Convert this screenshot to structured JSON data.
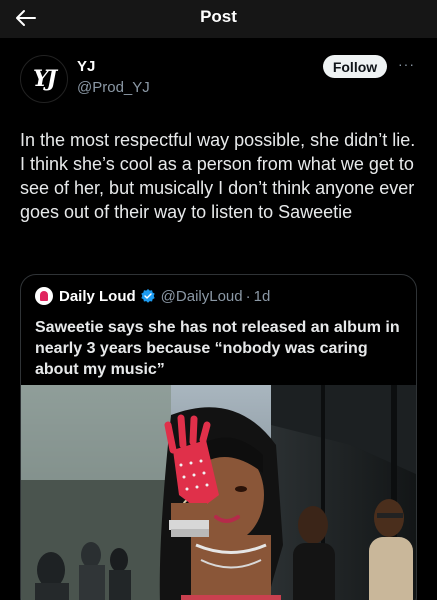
{
  "header": {
    "title": "Post",
    "back_icon": "arrow-left-icon"
  },
  "author": {
    "avatar_text": "YJ",
    "name": "YJ",
    "handle": "@Prod_YJ",
    "follow_label": "Follow",
    "more_label": "···"
  },
  "tweet": {
    "text": "In the most respectful way possible, she didn’t lie. I think she’s cool as a person from what we get to see of her, but musically I don’t think anyone ever goes out of their way to listen to Saweetie"
  },
  "quote": {
    "name": "Daily Loud",
    "verified": true,
    "handle": "@DailyLoud",
    "separator": "·",
    "time": "1d",
    "text": "Saweetie says she has not released an album in nearly 3 years because “nobody was caring about my music”",
    "media": "photo of a performer on stage wearing a red studded fingerless glove"
  },
  "colors": {
    "background": "#000000",
    "topbar": "#161616",
    "text": "#e7e9ea",
    "secondary": "#8b98a5",
    "verified": "#1d9bf0",
    "border": "#2f3336",
    "follow_bg": "#eff3f4"
  }
}
